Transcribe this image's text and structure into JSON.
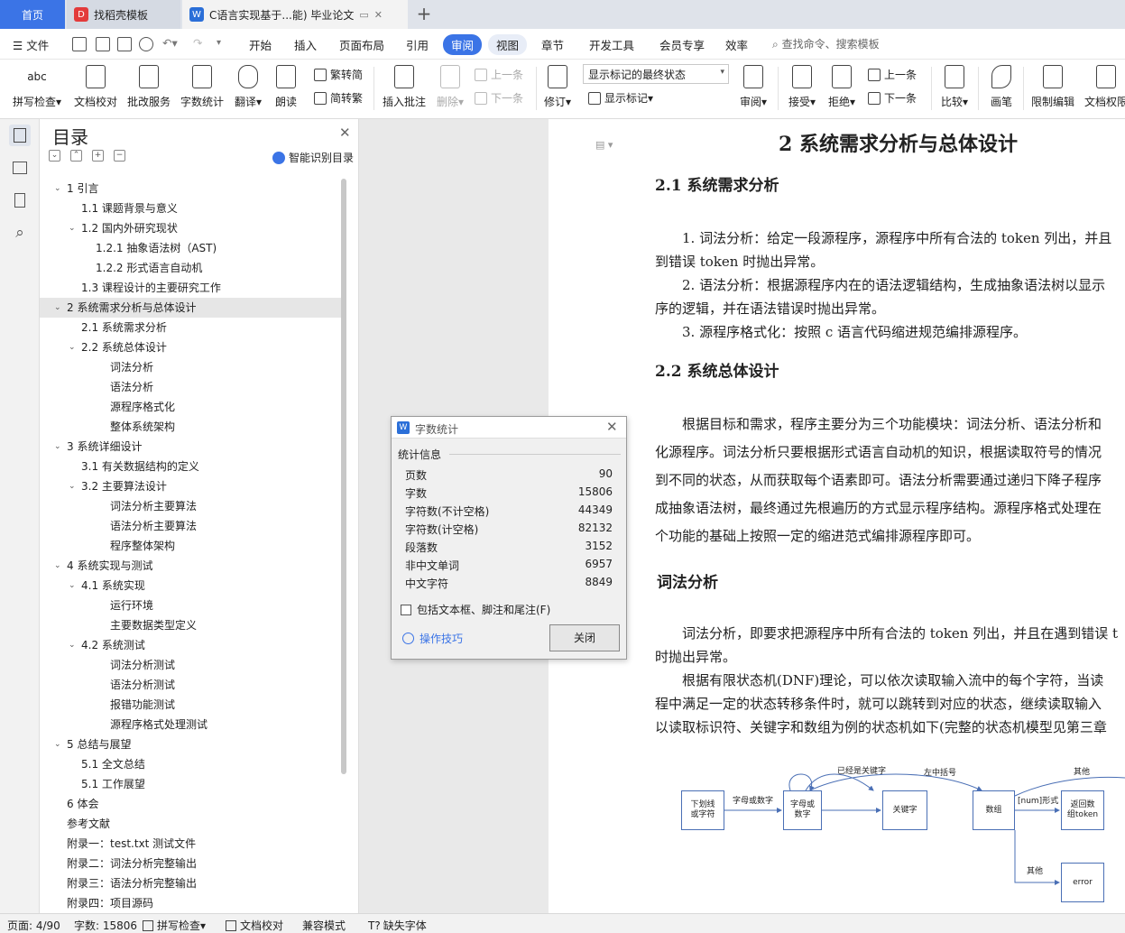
{
  "tabs": {
    "home": "首页",
    "doc1": "找稻壳模板",
    "doc2": "C语言实现基于...能)  毕业论文",
    "add": "+"
  },
  "menu": {
    "file": "文件",
    "items": [
      "开始",
      "插入",
      "页面布局",
      "引用",
      "审阅",
      "视图",
      "章节",
      "开发工具",
      "会员专享",
      "效率"
    ],
    "active": "审阅",
    "search": "查找命令、搜索模板"
  },
  "ribbon": {
    "spell": "拼写检查",
    "doccheck": "文档校对",
    "batch": "批改服务",
    "wordcount": "字数统计",
    "translate": "翻译",
    "read": "朗读",
    "trad": "繁转简",
    "simp": "简转繁",
    "insert_comment": "插入批注",
    "delete": "删除",
    "prev": "上一条",
    "next": "下一条",
    "markup_state": "显示标记的最终状态",
    "revise": "修订",
    "show_markup": "显示标记",
    "review": "审阅",
    "accept": "接受",
    "reject": "拒绝",
    "prev2": "上一条",
    "next2": "下一条",
    "compare": "比较",
    "pen": "画笔",
    "restrict": "限制编辑",
    "doc_perm": "文档权限",
    "abc": "abc"
  },
  "toc": {
    "title": "目录",
    "smart": "智能识别目录",
    "items": [
      {
        "t": "1 引言",
        "lv": 0,
        "c": 1
      },
      {
        "t": "1.1 课题背景与意义",
        "lv": 1,
        "c": 0
      },
      {
        "t": "1.2 国内外研究现状",
        "lv": 1,
        "c": 1
      },
      {
        "t": "1.2.1  抽象语法树（AST)",
        "lv": 2,
        "c": 0
      },
      {
        "t": "1.2.2  形式语言自动机",
        "lv": 2,
        "c": 0
      },
      {
        "t": "1.3 课程设计的主要研究工作",
        "lv": 1,
        "c": 0
      },
      {
        "t": "2 系统需求分析与总体设计",
        "lv": 0,
        "c": 1,
        "sel": 1
      },
      {
        "t": "2.1 系统需求分析",
        "lv": 1,
        "c": 0
      },
      {
        "t": "2.2 系统总体设计",
        "lv": 1,
        "c": 1
      },
      {
        "t": "词法分析",
        "lv": 3,
        "c": 0
      },
      {
        "t": "语法分析",
        "lv": 3,
        "c": 0
      },
      {
        "t": "源程序格式化",
        "lv": 3,
        "c": 0
      },
      {
        "t": "整体系统架构",
        "lv": 3,
        "c": 0
      },
      {
        "t": "3 系统详细设计",
        "lv": 0,
        "c": 1
      },
      {
        "t": "3.1 有关数据结构的定义",
        "lv": 1,
        "c": 0
      },
      {
        "t": "3.2  主要算法设计",
        "lv": 1,
        "c": 1
      },
      {
        "t": "词法分析主要算法",
        "lv": 3,
        "c": 0
      },
      {
        "t": "语法分析主要算法",
        "lv": 3,
        "c": 0
      },
      {
        "t": "程序整体架构",
        "lv": 3,
        "c": 0
      },
      {
        "t": "4 系统实现与测试",
        "lv": 0,
        "c": 1
      },
      {
        "t": "4.1  系统实现",
        "lv": 1,
        "c": 1
      },
      {
        "t": "运行环境",
        "lv": 3,
        "c": 0
      },
      {
        "t": "主要数据类型定义",
        "lv": 3,
        "c": 0
      },
      {
        "t": "4.2 系统测试",
        "lv": 1,
        "c": 1
      },
      {
        "t": "词法分析测试",
        "lv": 3,
        "c": 0
      },
      {
        "t": "语法分析测试",
        "lv": 3,
        "c": 0
      },
      {
        "t": "报错功能测试",
        "lv": 3,
        "c": 0
      },
      {
        "t": "源程序格式处理测试",
        "lv": 3,
        "c": 0
      },
      {
        "t": "5 总结与展望",
        "lv": 0,
        "c": 1
      },
      {
        "t": "5.1 全文总结",
        "lv": 1,
        "c": 0
      },
      {
        "t": "5.1 工作展望",
        "lv": 1,
        "c": 0
      },
      {
        "t": "6    体会",
        "lv": 4,
        "c": 0
      },
      {
        "t": "参考文献",
        "lv": 4,
        "c": 0
      },
      {
        "t": "附录一：test.txt 测试文件",
        "lv": 4,
        "c": 0
      },
      {
        "t": "附录二：词法分析完整输出",
        "lv": 4,
        "c": 0
      },
      {
        "t": "附录三：语法分析完整输出",
        "lv": 4,
        "c": 0
      },
      {
        "t": "附录四：项目源码",
        "lv": 4,
        "c": 0
      }
    ]
  },
  "doc": {
    "h1": "2 系统需求分析与总体设计",
    "h21": "2.1 系统需求分析",
    "p1a": "1.  词法分析：给定一段源程序，源程序中所有合法的 token 列出，并且",
    "p1b": "到错误 token 时抛出异常。",
    "p2a": "2.  语法分析：根据源程序内在的语法逻辑结构，生成抽象语法树以显示",
    "p2b": "序的逻辑，并在语法错误时抛出异常。",
    "p3": "3.  源程序格式化：按照 c 语言代码缩进规范编排源程序。",
    "h22": "2.2 系统总体设计",
    "p4": [
      "根据目标和需求，程序主要分为三个功能模块：词法分析、语法分析和",
      "化源程序。词法分析只要根据形式语言自动机的知识，根据读取符号的情况",
      "到不同的状态，从而获取每个语素即可。语法分析需要通过递归下降子程序",
      "成抽象语法树，最终通过先根遍历的方式显示程序结构。源程序格式处理在",
      "个功能的基础上按照一定的缩进范式编排源程序即可。"
    ],
    "h3": "词法分析",
    "p5a": "词法分析，即要求把源程序中所有合法的 token 列出，并且在遇到错误 t",
    "p5b": "时抛出异常。",
    "p6": [
      "根据有限状态机(DNF)理论，可以依次读取输入流中的每个字符，当读",
      "程中满足一定的状态转移条件时，就可以跳转到对应的状态，继续读取输入",
      "以读取标识符、关键字和数组为例的状态机如下(完整的状态机模型见第三章"
    ]
  },
  "diagram": {
    "n1": "下划线\n或字符",
    "n2": "字母或\n数字",
    "n3": "关键字",
    "n4": "数组",
    "n5": "返回数\n组token",
    "n6": "error",
    "l1": "字母或数字",
    "l2": "已经是关键字",
    "l3": "左中括号",
    "l4": "其他",
    "l5": "[num]形式",
    "l6": "其他"
  },
  "dialog": {
    "title": "字数统计",
    "group": "统计信息",
    "rows": [
      {
        "k": "页数",
        "v": "90"
      },
      {
        "k": "字数",
        "v": "15806"
      },
      {
        "k": "字符数(不计空格)",
        "v": "44349"
      },
      {
        "k": "字符数(计空格)",
        "v": "82132"
      },
      {
        "k": "段落数",
        "v": "3152"
      },
      {
        "k": "非中文单词",
        "v": "6957"
      },
      {
        "k": "中文字符",
        "v": "8849"
      }
    ],
    "checkbox": "包括文本框、脚注和尾注(F)",
    "tips": "操作技巧",
    "close": "关闭"
  },
  "status": {
    "page": "页面: 4/90",
    "words": "字数: 15806",
    "spell": "拼写检查",
    "doccheck": "文档校对",
    "compat": "兼容模式",
    "font": "缺失字体"
  }
}
